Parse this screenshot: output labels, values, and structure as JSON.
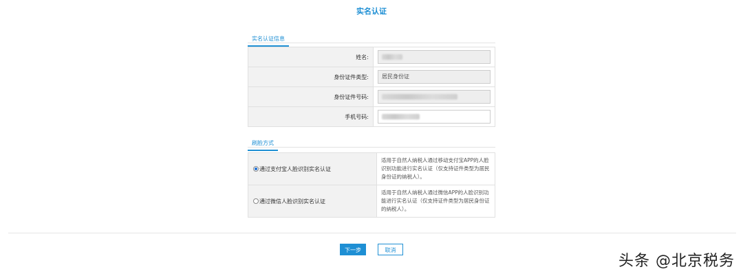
{
  "page": {
    "title": "实名认证"
  },
  "info_section": {
    "tab_label": "实名认证信息",
    "rows": [
      {
        "label": "姓名:",
        "value": ""
      },
      {
        "label": "身份证件类型:",
        "value": "居民身份证"
      },
      {
        "label": "身份证件号码:",
        "value": ""
      },
      {
        "label": "手机号码:",
        "value": ""
      }
    ]
  },
  "face_section": {
    "tab_label": "刷脸方式",
    "options": [
      {
        "label": "通过支付宝人脸识别实名认证",
        "selected": true,
        "description": "适用于自然人纳税人通过移动支付宝APP的人脸识别功能进行实名认证（仅支持证件类型为居民身份证的纳税人）。"
      },
      {
        "label": "通过微信人脸识别实名认证",
        "selected": false,
        "description": "适用于自然人纳税人通过微信APP的人脸识别功能进行实名认证（仅支持证件类型为居民身份证的纳税人）。"
      }
    ]
  },
  "actions": {
    "next_label": "下一步",
    "cancel_label": "取消"
  },
  "watermark": {
    "text": "头条 @北京税务"
  },
  "colors": {
    "accent": "#1e8fd4",
    "label_bg": "#f2f2f2",
    "readonly_bg": "#eeeeee"
  }
}
